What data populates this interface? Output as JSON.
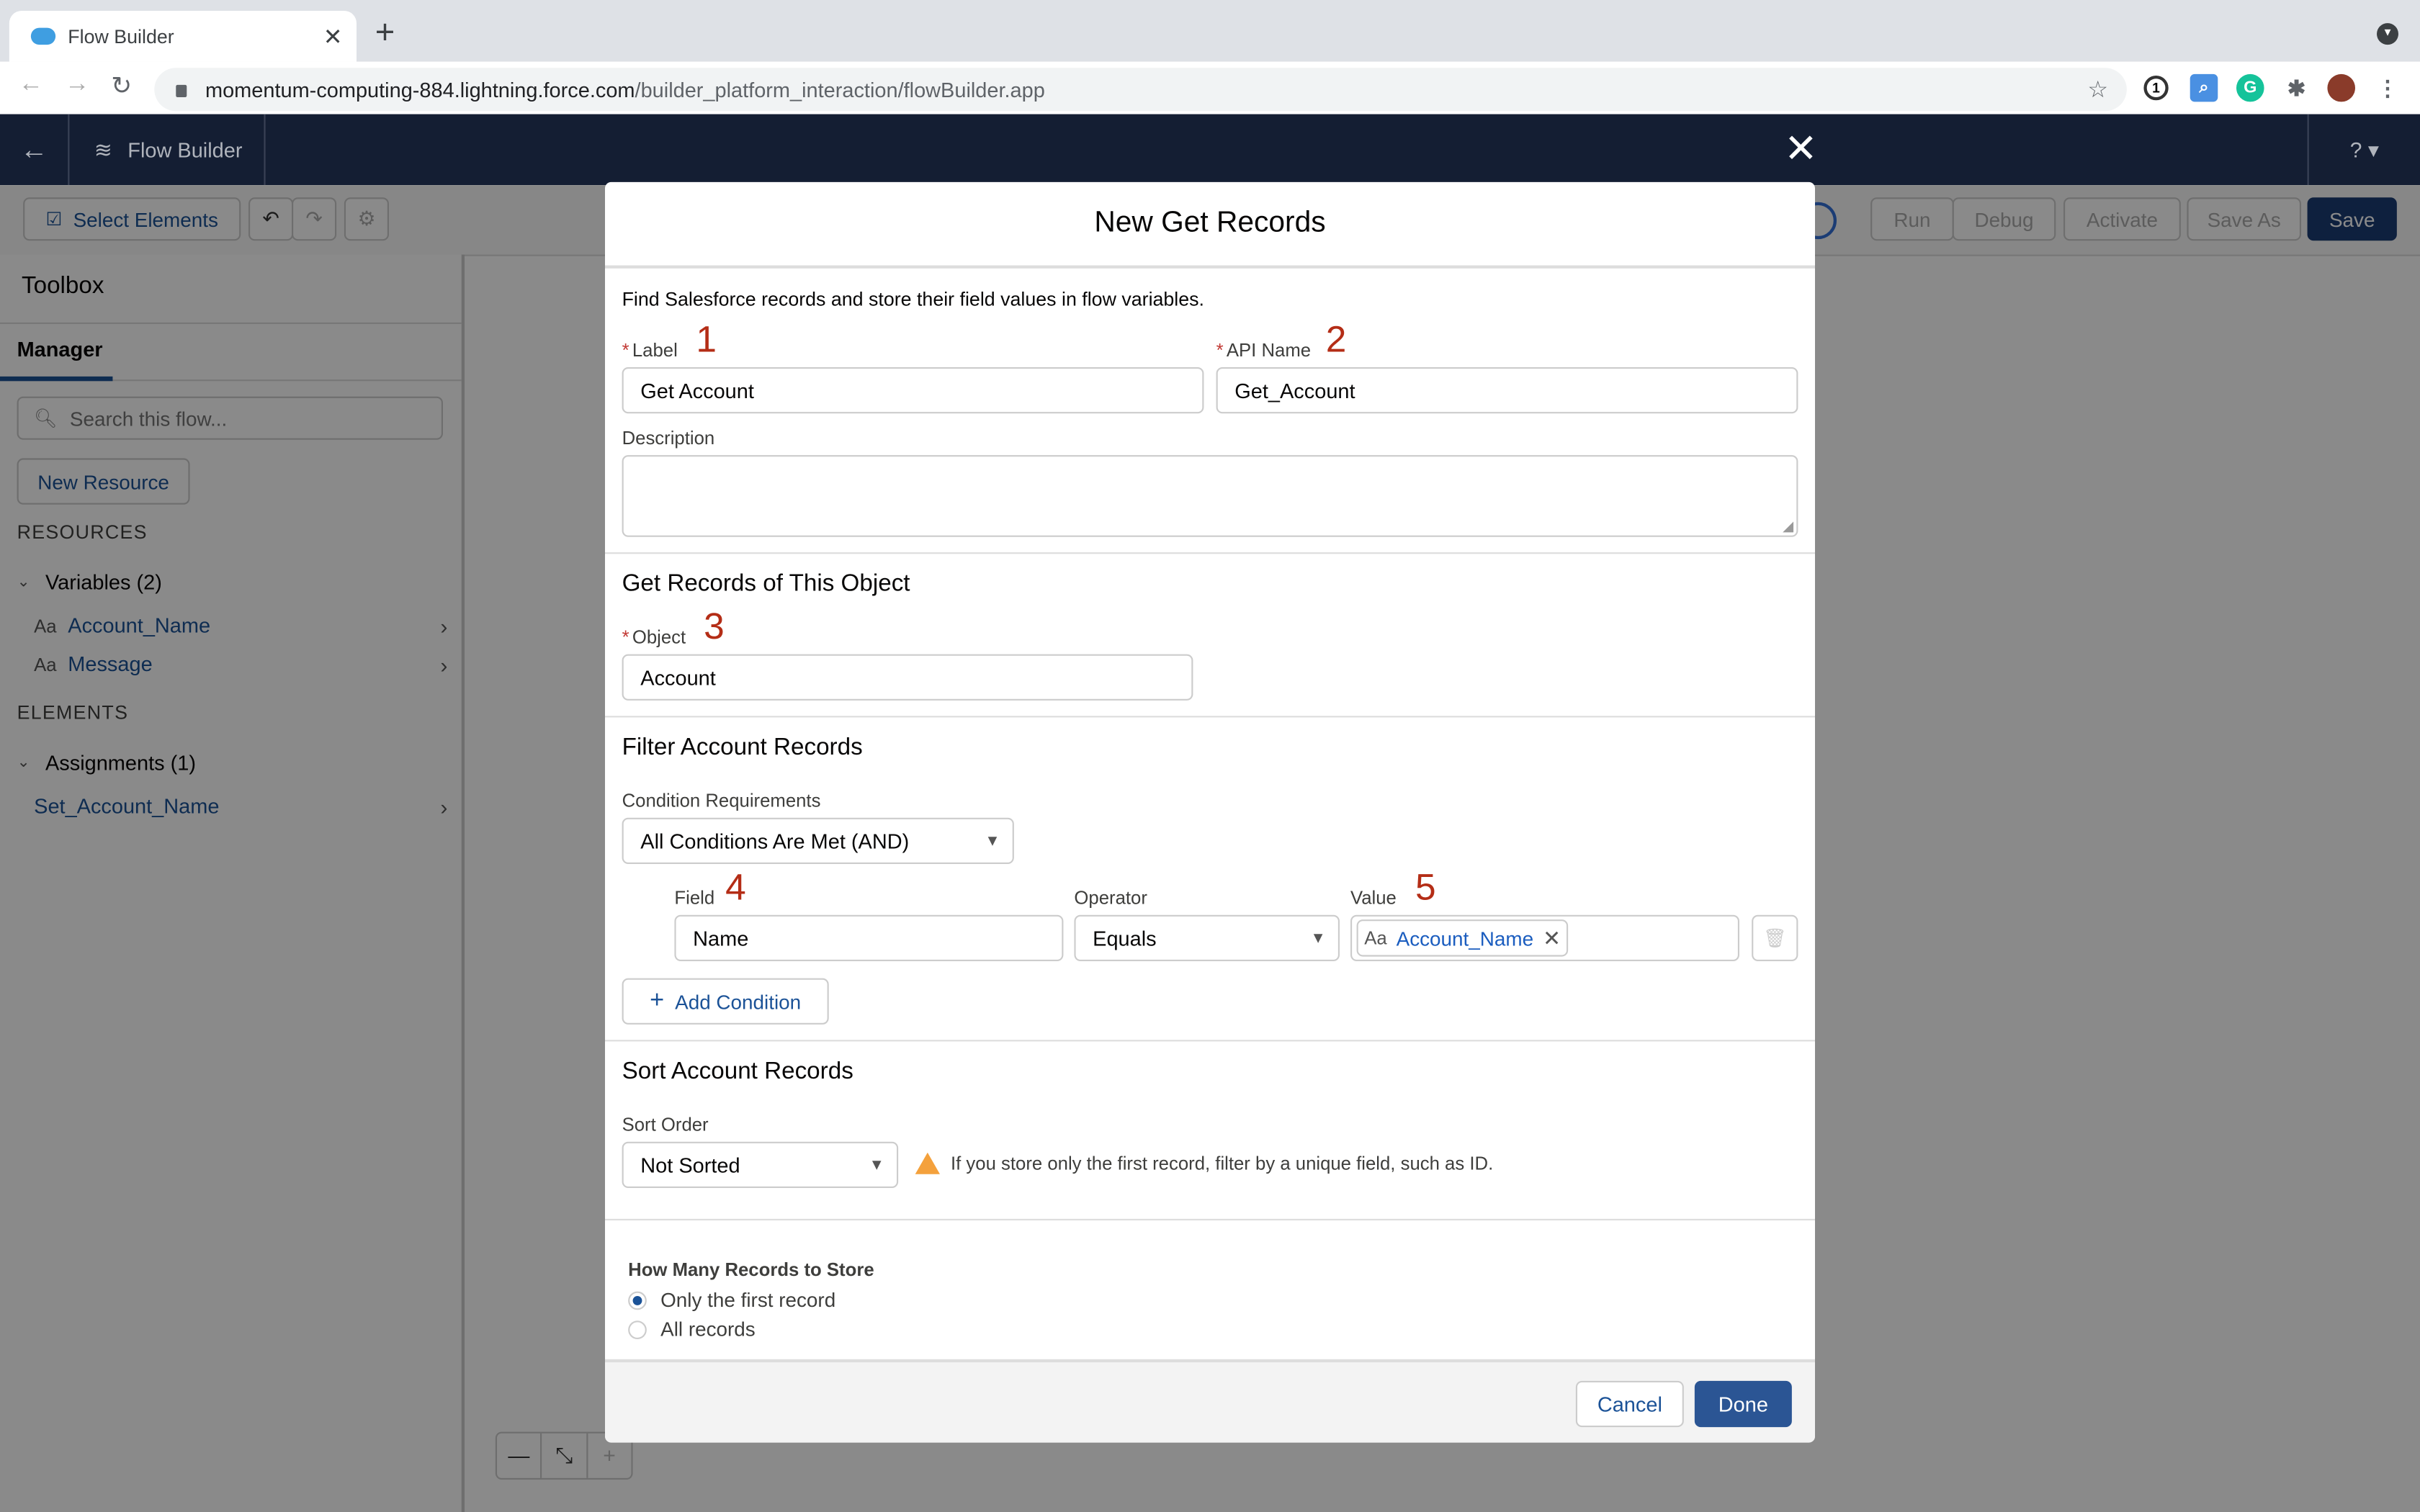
{
  "browser": {
    "tab_title": "Flow Builder",
    "url_host": "momentum-computing-884.lightning.force.com",
    "url_path": "/builder_platform_interaction/flowBuilder.app",
    "extensions": [
      "1password-icon",
      "search-extension-icon",
      "grammarly-icon",
      "extensions-puzzle-icon",
      "profile-avatar"
    ]
  },
  "app": {
    "title": "Flow Builder",
    "help_label": "?"
  },
  "toolbar": {
    "select_elements": "Select Elements",
    "run": "Run",
    "debug": "Debug",
    "activate": "Activate",
    "save_as": "Save As",
    "save": "Save"
  },
  "sidebar": {
    "title": "Toolbox",
    "tab": "Manager",
    "search_placeholder": "Search this flow...",
    "new_resource": "New Resource",
    "resources_heading": "RESOURCES",
    "variables_group": "Variables (2)",
    "variables": [
      {
        "name": "Account_Name",
        "type_icon": "Aa"
      },
      {
        "name": "Message",
        "type_icon": "Aa"
      }
    ],
    "elements_heading": "ELEMENTS",
    "assignments_group": "Assignments (1)",
    "assignments": [
      {
        "name": "Set_Account_Name"
      }
    ]
  },
  "modal": {
    "title": "New Get Records",
    "intro": "Find Salesforce records and store their field values in flow variables.",
    "label_label": "Label",
    "label_value": "Get Account",
    "api_name_label": "API Name",
    "api_name_value": "Get_Account",
    "description_label": "Description",
    "description_value": "",
    "object_section": "Get Records of This Object",
    "object_label": "Object",
    "object_value": "Account",
    "filter_section": "Filter Account Records",
    "condition_req_label": "Condition Requirements",
    "condition_req_value": "All Conditions Are Met (AND)",
    "field_label": "Field",
    "field_value": "Name",
    "operator_label": "Operator",
    "operator_value": "Equals",
    "value_label": "Value",
    "value_pill": "Account_Name",
    "value_pill_icon": "Aa",
    "add_condition": "Add Condition",
    "sort_section": "Sort Account Records",
    "sort_order_label": "Sort Order",
    "sort_order_value": "Not Sorted",
    "sort_warning": "If you store only the first record, filter by a unique field, such as ID.",
    "how_many_label": "How Many Records to Store",
    "radio_options": [
      {
        "label": "Only the first record",
        "selected": true
      },
      {
        "label": "All records",
        "selected": false
      }
    ],
    "cancel": "Cancel",
    "done": "Done"
  },
  "annotations": [
    "1",
    "2",
    "3",
    "4",
    "5"
  ],
  "colors": {
    "brand": "#1b3c74",
    "link": "#1b5297",
    "annotation": "#b42d16",
    "warning": "#f4a13c",
    "app_header": "#141e33"
  }
}
